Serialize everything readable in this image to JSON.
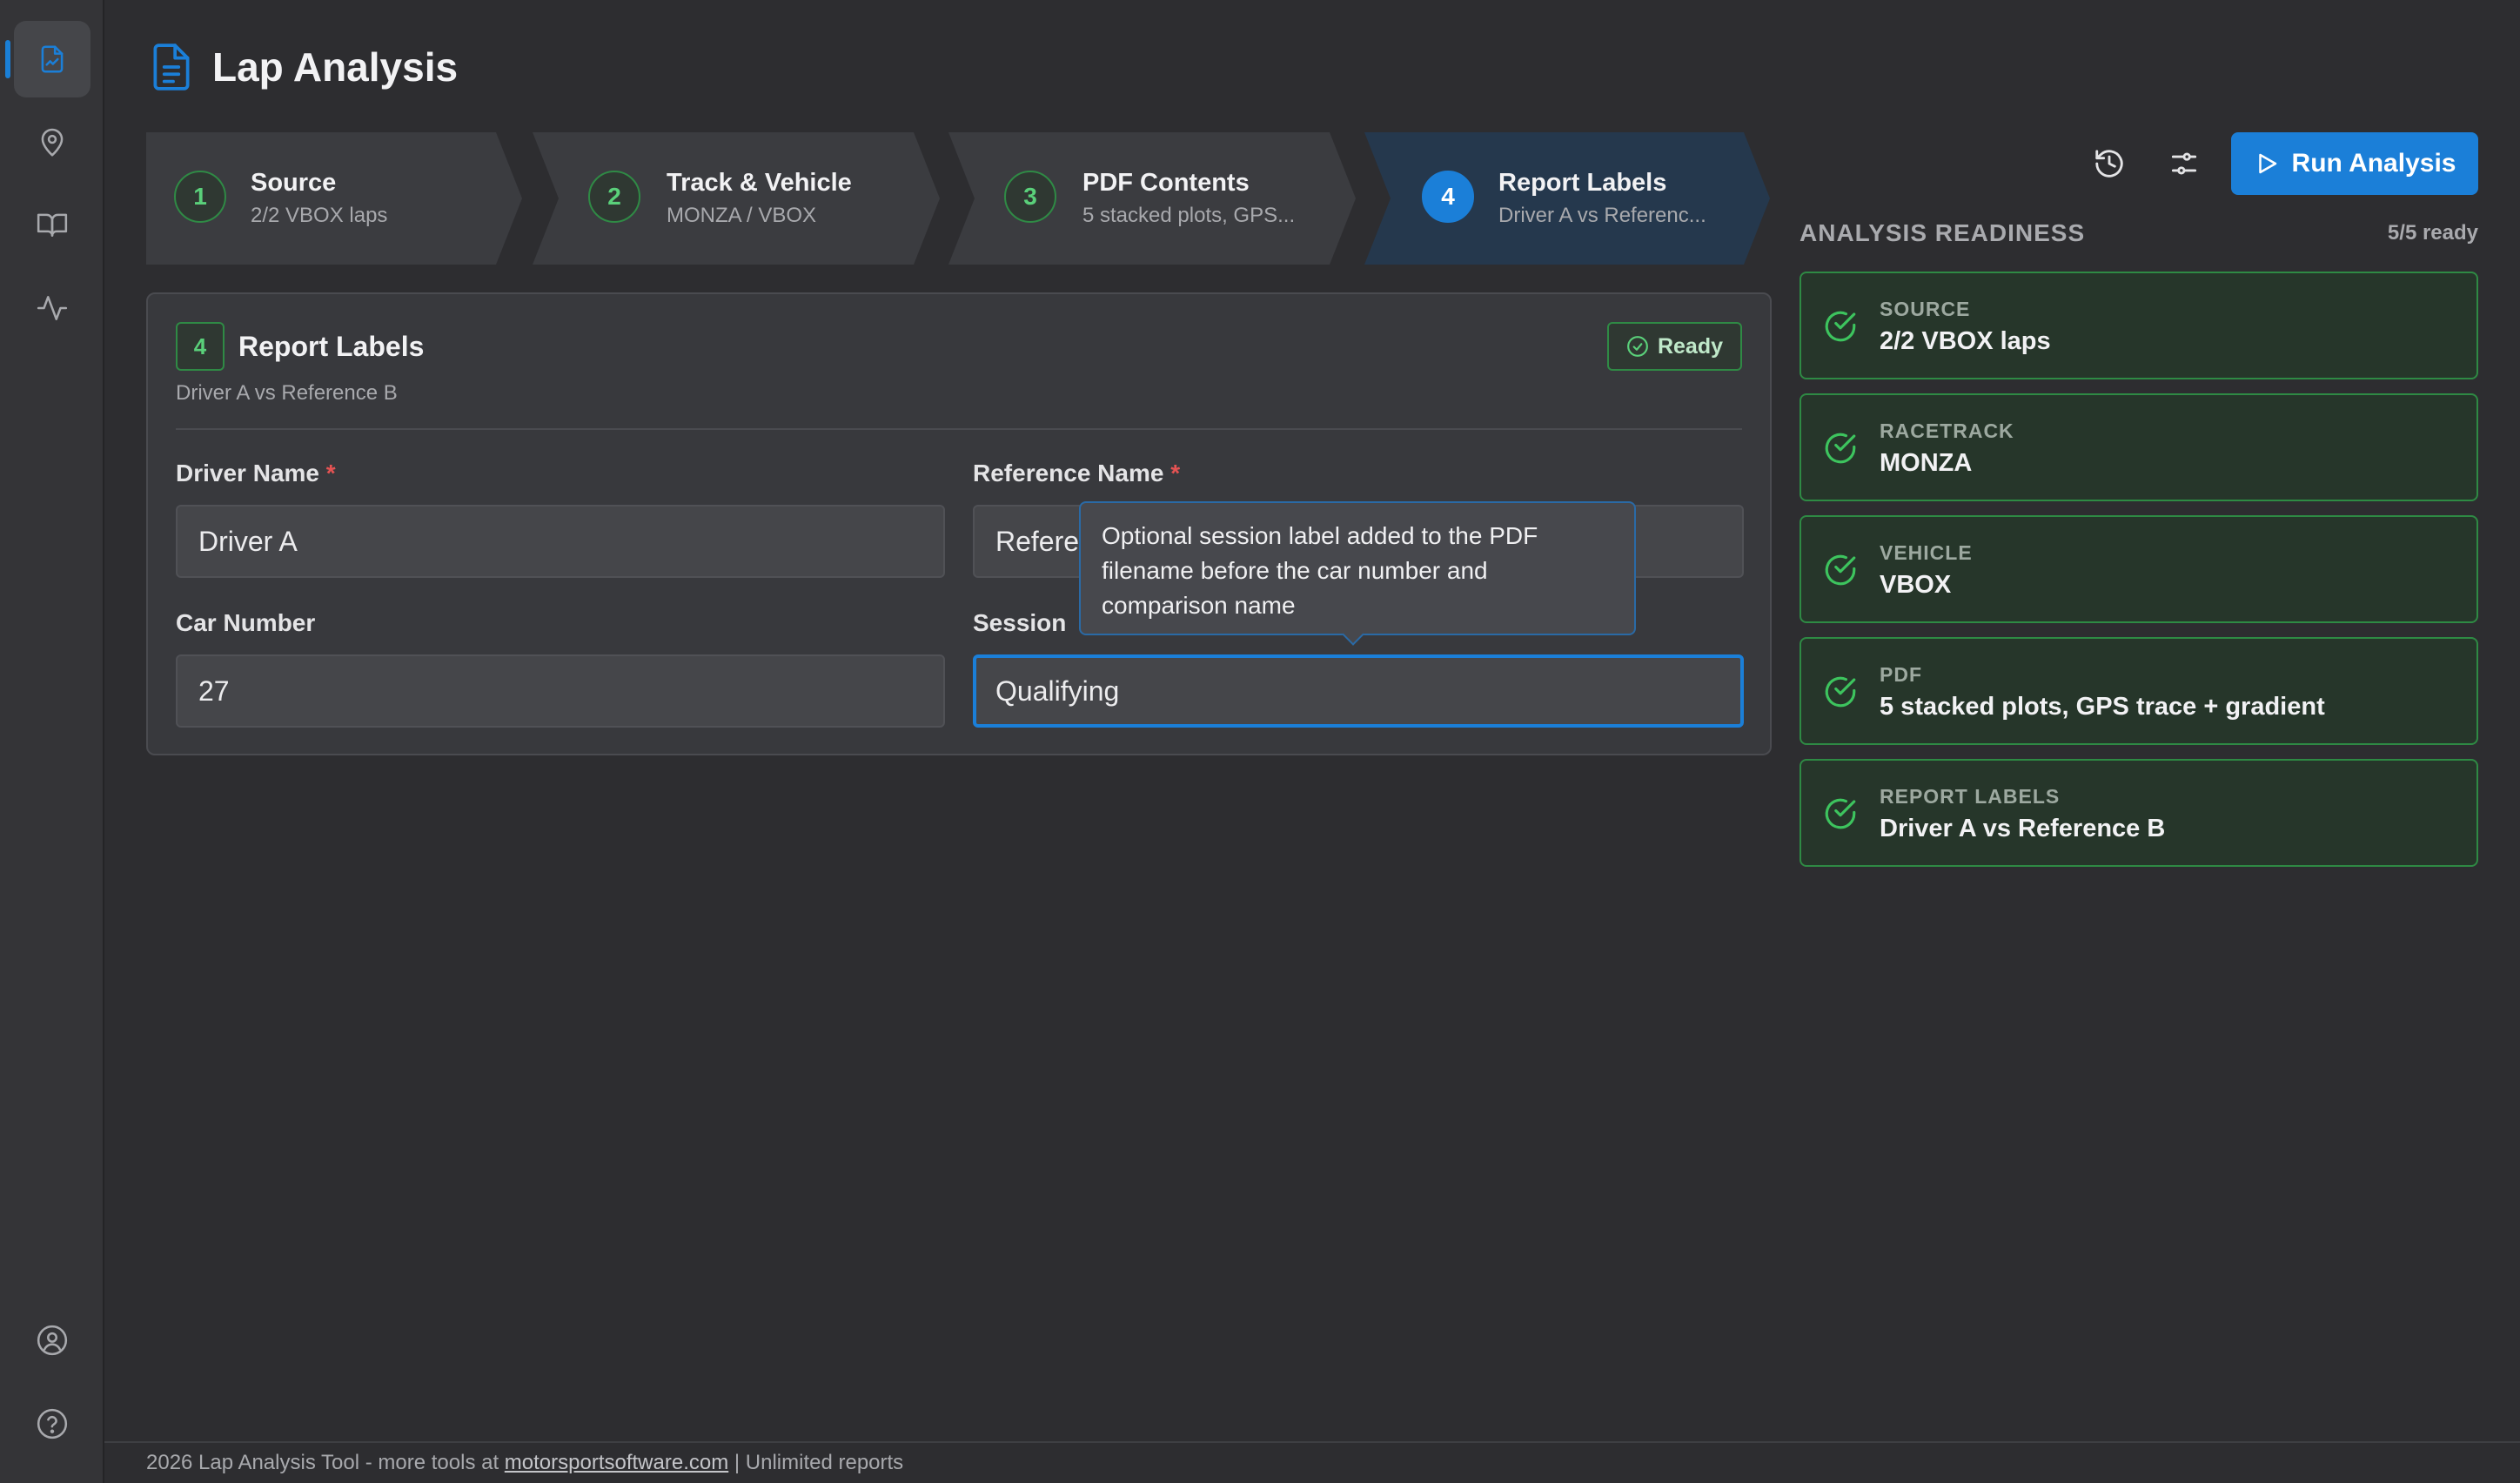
{
  "app": {
    "title": "Lap Analysis"
  },
  "steps": [
    {
      "num": "1",
      "title": "Source",
      "sub": "2/2 VBOX laps"
    },
    {
      "num": "2",
      "title": "Track & Vehicle",
      "sub": "MONZA / VBOX"
    },
    {
      "num": "3",
      "title": "PDF Contents",
      "sub": "5 stacked plots, GPS..."
    },
    {
      "num": "4",
      "title": "Report Labels",
      "sub": "Driver A vs Referenc..."
    }
  ],
  "panel": {
    "badge": "4",
    "title": "Report Labels",
    "subtitle": "Driver A vs Reference B",
    "status": "Ready",
    "fields": {
      "driver_label": "Driver Name",
      "driver_value": "Driver A",
      "reference_label": "Reference Name",
      "reference_value": "Refere",
      "car_label": "Car Number",
      "car_value": "27",
      "session_label": "Session",
      "session_value": "Qualifying",
      "required_mark": "*"
    },
    "tooltip": "Optional session label added to the PDF filename before the car number and comparison name"
  },
  "toolbar": {
    "run_label": "Run Analysis"
  },
  "readiness": {
    "title": "ANALYSIS READINESS",
    "count": "5/5 ready",
    "items": [
      {
        "label": "SOURCE",
        "value": "2/2 VBOX laps"
      },
      {
        "label": "RACETRACK",
        "value": "MONZA"
      },
      {
        "label": "VEHICLE",
        "value": "VBOX"
      },
      {
        "label": "PDF",
        "value": "5 stacked plots, GPS trace + gradient"
      },
      {
        "label": "REPORT LABELS",
        "value": "Driver A vs Reference B"
      }
    ]
  },
  "footer": {
    "prefix": "2026 Lap Analysis Tool - more tools at ",
    "link": "motorsportsoftware.com",
    "suffix": " | Unlimited reports"
  },
  "colors": {
    "accent": "#1b7fd8",
    "success": "#2e8a44",
    "background": "#2d2d30"
  },
  "icons": {
    "sidebar": [
      "report-icon",
      "map-pin-icon",
      "book-icon",
      "activity-icon",
      "user-icon",
      "help-icon"
    ],
    "header": "document-icon",
    "toolbar": [
      "history-icon",
      "sliders-icon",
      "play-icon"
    ]
  }
}
